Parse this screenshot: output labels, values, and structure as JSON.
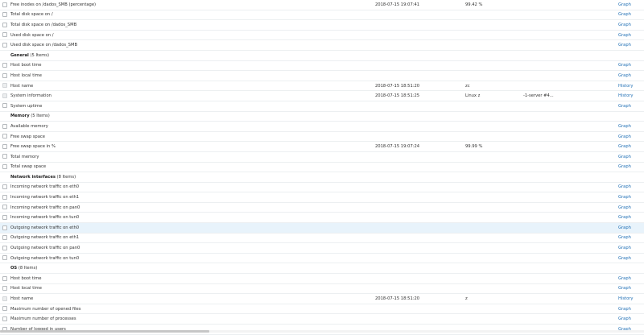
{
  "rows": [
    {
      "type": "item",
      "name": "Free inodes on /dados_SMB (percentage)",
      "ts": "2018-07-15 19:07:41",
      "val": "99.42 %",
      "val2": "",
      "action": "Graph",
      "disabled": false,
      "hl": false
    },
    {
      "type": "item",
      "name": "Total disk space on /",
      "ts": "",
      "val": "",
      "val2": "",
      "action": "Graph",
      "disabled": false,
      "hl": false
    },
    {
      "type": "item",
      "name": "Total disk space on /dados_SMB",
      "ts": "",
      "val": "",
      "val2": "",
      "action": "Graph",
      "disabled": false,
      "hl": false
    },
    {
      "type": "item",
      "name": "Used disk space on /",
      "ts": "",
      "val": "",
      "val2": "",
      "action": "Graph",
      "disabled": false,
      "hl": false
    },
    {
      "type": "item",
      "name": "Used disk space on /dados_SMB",
      "ts": "",
      "val": "",
      "val2": "",
      "action": "Graph",
      "disabled": false,
      "hl": false
    },
    {
      "type": "group",
      "title": "General",
      "count": "(5 Items)"
    },
    {
      "type": "item",
      "name": "Host boot time",
      "ts": "",
      "val": "",
      "val2": "",
      "action": "Graph",
      "disabled": false,
      "hl": false
    },
    {
      "type": "item",
      "name": "Host local time",
      "ts": "",
      "val": "",
      "val2": "",
      "action": "Graph",
      "disabled": false,
      "hl": false
    },
    {
      "type": "item",
      "name": "Host name",
      "ts": "2018-07-15 18:51:20",
      "val": "zc",
      "val2": "",
      "action": "History",
      "disabled": true,
      "hl": false
    },
    {
      "type": "item",
      "name": "System information",
      "ts": "2018-07-15 18:51:25",
      "val": "Linux z",
      "val2": "-1-server #4...",
      "action": "History",
      "disabled": true,
      "hl": false
    },
    {
      "type": "item",
      "name": "System uptime",
      "ts": "",
      "val": "",
      "val2": "",
      "action": "Graph",
      "disabled": false,
      "hl": false
    },
    {
      "type": "group",
      "title": "Memory",
      "count": "(5 Items)"
    },
    {
      "type": "item",
      "name": "Available memory",
      "ts": "",
      "val": "",
      "val2": "",
      "action": "Graph",
      "disabled": false,
      "hl": false
    },
    {
      "type": "item",
      "name": "Free swap space",
      "ts": "",
      "val": "",
      "val2": "",
      "action": "Graph",
      "disabled": false,
      "hl": false
    },
    {
      "type": "item",
      "name": "Free swap space in %",
      "ts": "2018-07-15 19:07:24",
      "val": "99.99 %",
      "val2": "",
      "action": "Graph",
      "disabled": false,
      "hl": false
    },
    {
      "type": "item",
      "name": "Total memory",
      "ts": "",
      "val": "",
      "val2": "",
      "action": "Graph",
      "disabled": false,
      "hl": false
    },
    {
      "type": "item",
      "name": "Total swap space",
      "ts": "",
      "val": "",
      "val2": "",
      "action": "Graph",
      "disabled": false,
      "hl": false
    },
    {
      "type": "group",
      "title": "Network interfaces",
      "count": "(8 Items)"
    },
    {
      "type": "item",
      "name": "Incoming network traffic on eth0",
      "ts": "",
      "val": "",
      "val2": "",
      "action": "Graph",
      "disabled": false,
      "hl": false
    },
    {
      "type": "item",
      "name": "Incoming network traffic on eth1",
      "ts": "",
      "val": "",
      "val2": "",
      "action": "Graph",
      "disabled": false,
      "hl": false
    },
    {
      "type": "item",
      "name": "Incoming network traffic on pan0",
      "ts": "",
      "val": "",
      "val2": "",
      "action": "Graph",
      "disabled": false,
      "hl": false
    },
    {
      "type": "item",
      "name": "Incoming network traffic on tun0",
      "ts": "",
      "val": "",
      "val2": "",
      "action": "Graph",
      "disabled": false,
      "hl": false
    },
    {
      "type": "item",
      "name": "Outgoing network traffic on eth0",
      "ts": "",
      "val": "",
      "val2": "",
      "action": "Graph",
      "disabled": false,
      "hl": true
    },
    {
      "type": "item",
      "name": "Outgoing network traffic on eth1",
      "ts": "",
      "val": "",
      "val2": "",
      "action": "Graph",
      "disabled": false,
      "hl": false
    },
    {
      "type": "item",
      "name": "Outgoing network traffic on pan0",
      "ts": "",
      "val": "",
      "val2": "",
      "action": "Graph",
      "disabled": false,
      "hl": false
    },
    {
      "type": "item",
      "name": "Outgoing network traffic on tun0",
      "ts": "",
      "val": "",
      "val2": "",
      "action": "Graph",
      "disabled": false,
      "hl": false
    },
    {
      "type": "group",
      "title": "OS",
      "count": "(8 Items)"
    },
    {
      "type": "item",
      "name": "Host boot time",
      "ts": "",
      "val": "",
      "val2": "",
      "action": "Graph",
      "disabled": false,
      "hl": false
    },
    {
      "type": "item",
      "name": "Host local time",
      "ts": "",
      "val": "",
      "val2": "",
      "action": "Graph",
      "disabled": false,
      "hl": false
    },
    {
      "type": "item",
      "name": "Host name",
      "ts": "2018-07-15 18:51:20",
      "val": "z",
      "val2": "",
      "action": "History",
      "disabled": true,
      "hl": false
    },
    {
      "type": "item",
      "name": "Maximum number of opened files",
      "ts": "",
      "val": "",
      "val2": "",
      "action": "Graph",
      "disabled": false,
      "hl": false
    },
    {
      "type": "item",
      "name": "Maximum number of processes",
      "ts": "",
      "val": "",
      "val2": "",
      "action": "Graph",
      "disabled": false,
      "hl": false
    },
    {
      "type": "item",
      "name": "Number of logged in users",
      "ts": "",
      "val": "",
      "val2": "",
      "action": "Graph",
      "disabled": false,
      "hl": false
    }
  ]
}
